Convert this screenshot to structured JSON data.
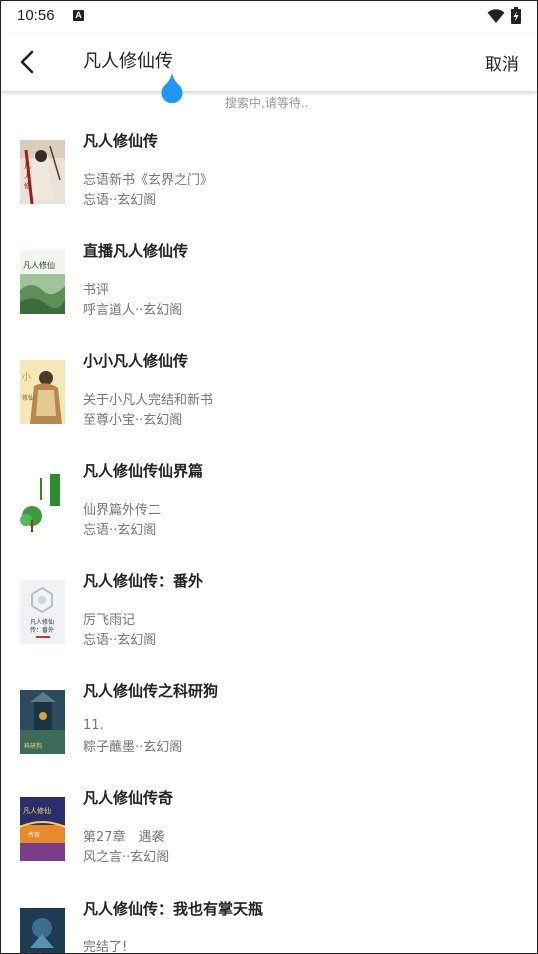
{
  "status": {
    "time": "10:56",
    "notification_icon": "A"
  },
  "toolbar": {
    "search_value": "凡人修仙传",
    "cancel_label": "取消"
  },
  "loading_text": "搜索中,请等待..",
  "books": [
    {
      "title": "凡人修仙传",
      "latest": "忘语新书《玄界之门》",
      "meta": "忘语··玄幻阁"
    },
    {
      "title": "直播凡人修仙传",
      "latest": "书评",
      "meta": "呼言道人··玄幻阁"
    },
    {
      "title": "小小凡人修仙传",
      "latest": "关于小凡人完结和新书",
      "meta": "至尊小宝··玄幻阁"
    },
    {
      "title": "凡人修仙传仙界篇",
      "latest": "仙界篇外传二",
      "meta": "忘语··玄幻阁"
    },
    {
      "title": "凡人修仙传：番外",
      "latest": "厉飞雨记",
      "meta": "忘语··玄幻阁"
    },
    {
      "title": "凡人修仙传之科研狗",
      "latest": "11.",
      "meta": "粽子蘸墨··玄幻阁"
    },
    {
      "title": "凡人修仙传奇",
      "latest": "第27章　遇袭",
      "meta": "风之言··玄幻阁"
    },
    {
      "title": "凡人修仙传：我也有掌天瓶",
      "latest": "完结了!",
      "meta": ""
    }
  ],
  "colors": {
    "accent": "#2196F3"
  }
}
